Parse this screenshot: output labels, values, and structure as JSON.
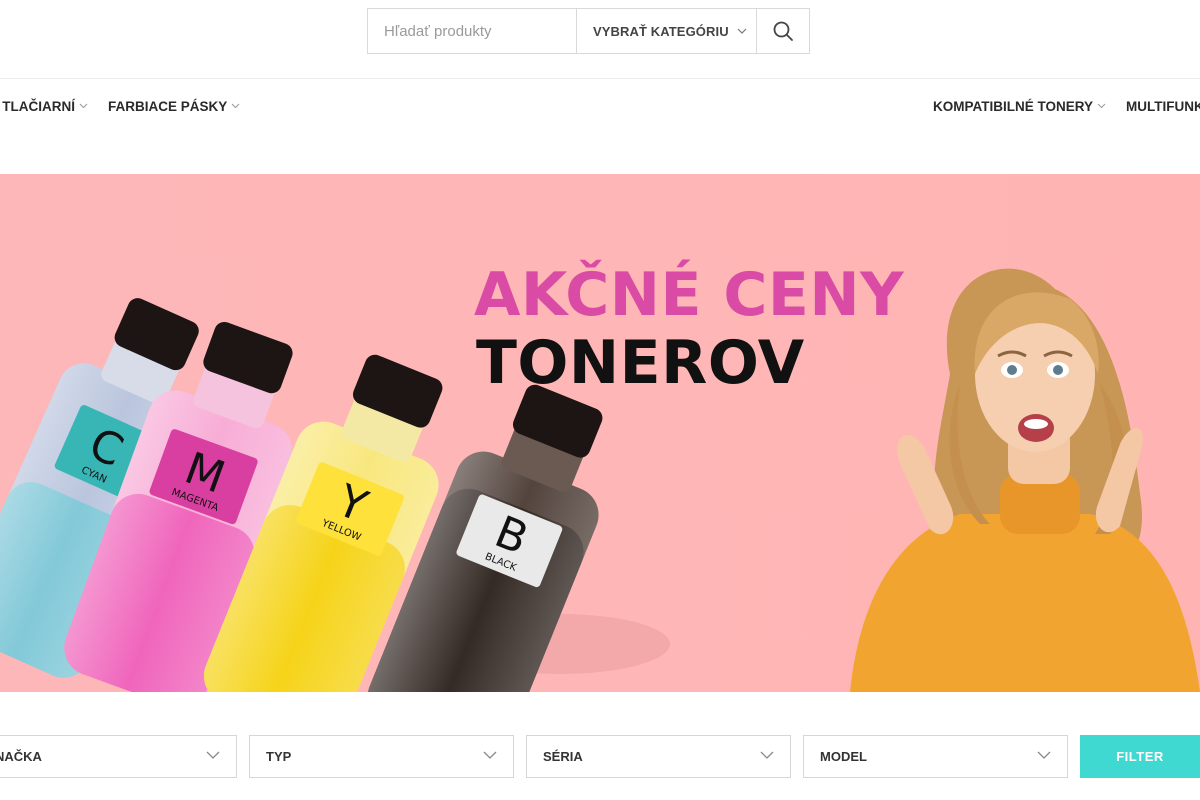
{
  "search": {
    "placeholder": "Hľadať produkty",
    "category_label": "VYBRAŤ KATEGÓRIU"
  },
  "nav": {
    "left_items": [
      {
        "label": "O TLAČIARNÍ"
      },
      {
        "label": "FARBIACE PÁSKY"
      }
    ],
    "right_items": [
      {
        "label": "KOMPATIBILNÉ TONERY"
      },
      {
        "label": "MULTIFUNK"
      }
    ]
  },
  "hero": {
    "title_line1": "AKČNÉ CENY",
    "title_line2": "TONEROV",
    "bottles": [
      {
        "letter": "C",
        "name": "CYAN",
        "color": "#7cc6d6"
      },
      {
        "letter": "M",
        "name": "MAGENTA",
        "color": "#ef5db8"
      },
      {
        "letter": "Y",
        "name": "YELLOW",
        "color": "#f5d10d"
      },
      {
        "letter": "B",
        "name": "BLACK",
        "color": "#2a1f1a"
      }
    ],
    "colors": {
      "background": "#ffb6b6",
      "accent": "#d94ba4",
      "sweater": "#f2a431"
    }
  },
  "filters": {
    "items": [
      {
        "label": "ZNAČKA"
      },
      {
        "label": "TYP"
      },
      {
        "label": "SÉRIA"
      },
      {
        "label": "MODEL"
      }
    ],
    "button_label": "FILTER",
    "button_color": "#3fd9d1"
  }
}
